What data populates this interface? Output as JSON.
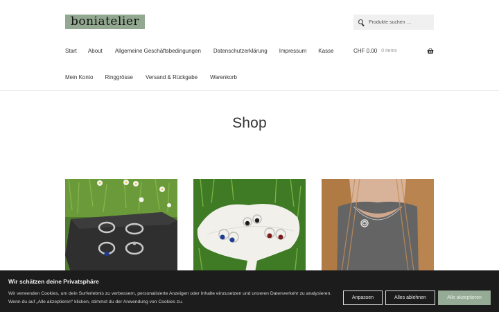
{
  "site": {
    "logo_text": "boniatelier"
  },
  "search": {
    "placeholder": "Produkte suchen …"
  },
  "nav": {
    "row1": [
      "Start",
      "About",
      "Allgemeine Geschäftsbedingungen",
      "Datenschutzerklärung",
      "Impressum",
      "Kasse"
    ],
    "row2": [
      "Mein Konto",
      "Ringgrösse",
      "Versand & Rückgabe",
      "Warenkorb"
    ]
  },
  "cart": {
    "total": "CHF 0.00",
    "items": "0 items"
  },
  "page": {
    "title": "Shop"
  },
  "products": [
    {
      "name": "rings-on-slate-image"
    },
    {
      "name": "earrings-on-ginkgo-dish-image"
    },
    {
      "name": "spiral-necklace-image"
    }
  ],
  "cookie": {
    "title": "Wir schätzen deine Privatsphäre",
    "text": "Wir verwenden Cookies, um dein Surferlebnis zu verbessern, personalisierte Anzeigen oder Inhalte einzusetzen und unseren Datenverkehr zu analysieren. Wenn du auf „Alle akzeptieren“ klicken, stimmst du der Anwendung von Cookies zu.",
    "customize": "Anpassen",
    "reject": "Alles ablehnen",
    "accept": "Alle akzeptieren"
  },
  "colors": {
    "accent": "#96ab96",
    "banner_bg": "#1c1c1c",
    "logo_bg": "#92a890"
  }
}
